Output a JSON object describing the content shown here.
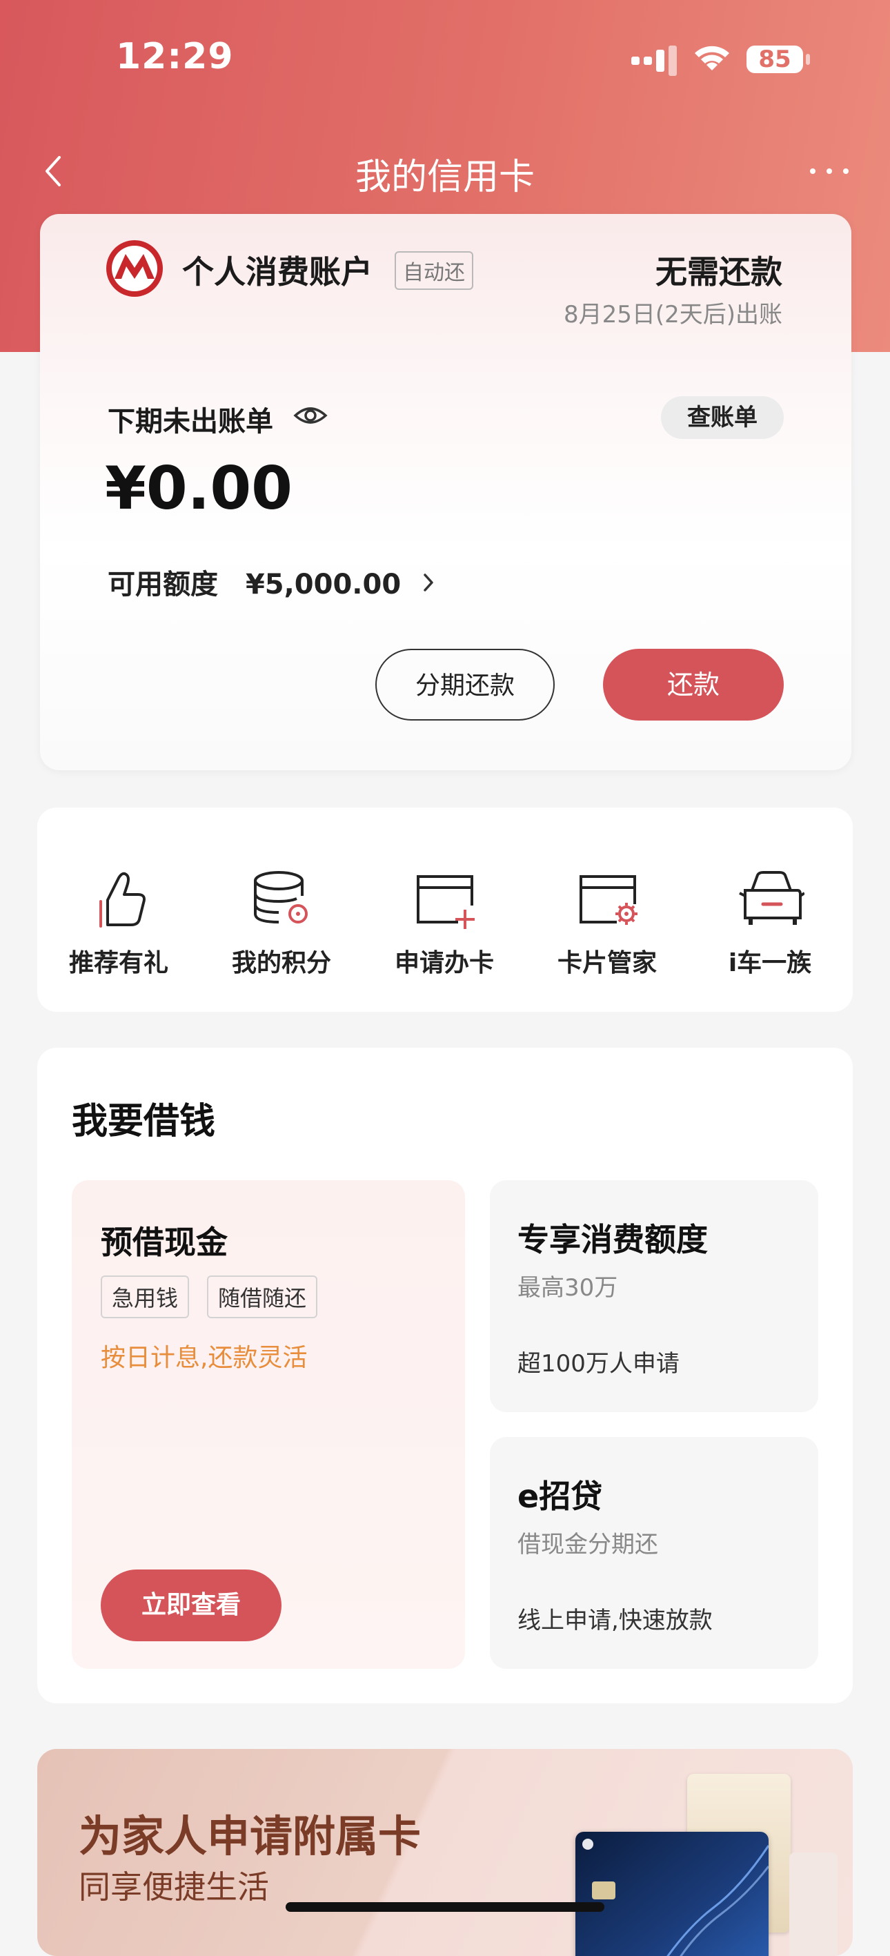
{
  "status_bar": {
    "time": "12:29",
    "battery": "85"
  },
  "nav": {
    "title": "我的信用卡"
  },
  "account": {
    "name": "个人消费账户",
    "auto_badge": "自动还",
    "status": "无需还款",
    "bill_date": "8月25日(2天后)出账",
    "next_bill_label": "下期未出账单",
    "view_bill": "查账单",
    "amount": "¥0.00",
    "limit_label": "可用额度",
    "limit_value": "¥5,000.00",
    "btn_install": "分期还款",
    "btn_repay": "还款"
  },
  "shortcuts": [
    {
      "label": "推荐有礼",
      "icon": "thumbs-up-icon"
    },
    {
      "label": "我的积分",
      "icon": "points-stack-icon"
    },
    {
      "label": "申请办卡",
      "icon": "card-add-icon"
    },
    {
      "label": "卡片管家",
      "icon": "card-settings-icon"
    },
    {
      "label": "i车一族",
      "icon": "car-icon"
    }
  ],
  "borrow": {
    "title": "我要借钱",
    "pre_cash": {
      "title": "预借现金",
      "tags": [
        "急用钱",
        "随借随还"
      ],
      "desc": "按日计息,还款灵活",
      "button": "立即查看"
    },
    "exclusive": {
      "title": "专享消费额度",
      "sub": "最高30万",
      "desc": "超100万人申请"
    },
    "eloan": {
      "title": "e招贷",
      "sub": "借现金分期还",
      "desc": "线上申请,快速放款"
    }
  },
  "banner": {
    "title": "为家人申请附属卡",
    "subtitle": "同享便捷生活"
  },
  "colors": {
    "brand_red": "#d5545a",
    "header_gradient_start": "#d8585c",
    "header_gradient_end": "#eb8b7d",
    "accent_orange": "#e88d3c"
  }
}
